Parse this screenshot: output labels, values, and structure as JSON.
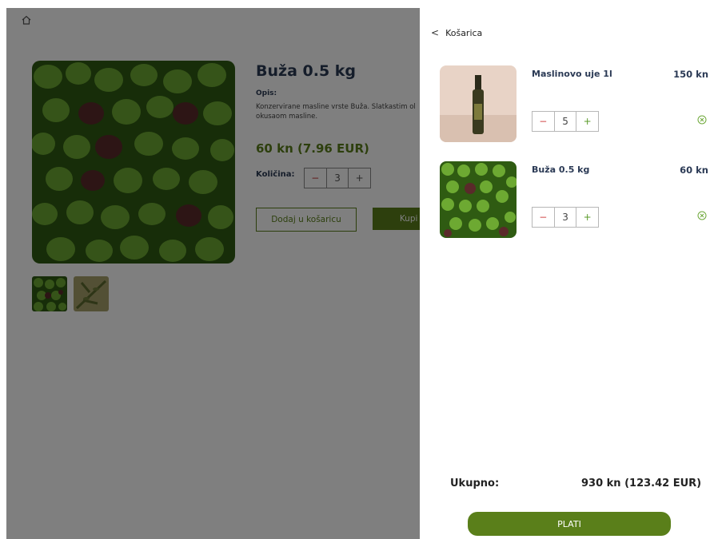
{
  "product": {
    "title": "Buža 0.5 kg",
    "desc_label": "Opis:",
    "description": "Konzervirane masline vrste Buža. Slatkastim ol okusaom masline.",
    "price": "60 kn (7.96 EUR)",
    "qty_label": "Količina:",
    "qty": "3",
    "minus": "−",
    "plus": "+",
    "add_to_cart": "Dodaj u košaricu",
    "buy": "Kupi o"
  },
  "cart": {
    "back": "<",
    "title": "Košarica",
    "items": [
      {
        "name": "Maslinovo uje 1l",
        "price": "150 kn",
        "qty": "5",
        "minus": "−",
        "plus": "+"
      },
      {
        "name": "Buža 0.5 kg",
        "price": "60 kn",
        "qty": "3",
        "minus": "−",
        "plus": "+"
      }
    ],
    "total_label": "Ukupno:",
    "total_value": "930 kn (123.42 EUR)",
    "pay_label": "PLATI"
  },
  "colors": {
    "accent": "#5a7f1a",
    "title": "#2b3a55",
    "overlay": "rgba(0,0,0,0.5)"
  },
  "icons": [
    "home-icon",
    "chevron-left-icon",
    "remove-icon"
  ]
}
